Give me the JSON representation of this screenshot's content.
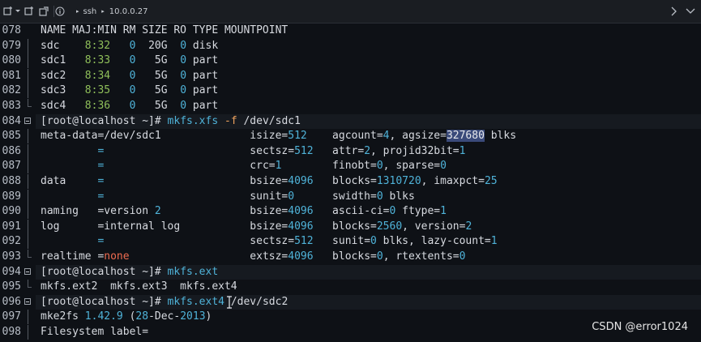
{
  "titlebar": {
    "ssh_label": "ssh",
    "host": "10.0.0.27"
  },
  "lines": [
    {
      "n": "078",
      "segs": [
        {
          "t": "NAME MAJ:MIN RM SIZE RO TYPE MOUNTPOINT",
          "c": ""
        }
      ]
    },
    {
      "n": "079",
      "segs": [
        {
          "t": "sdc    ",
          "c": ""
        },
        {
          "t": "8:32",
          "c": "c-green"
        },
        {
          "t": "   ",
          "c": ""
        },
        {
          "t": "0",
          "c": "c-cyan"
        },
        {
          "t": "  20G  ",
          "c": ""
        },
        {
          "t": "0",
          "c": "c-cyan"
        },
        {
          "t": " disk",
          "c": ""
        }
      ]
    },
    {
      "n": "080",
      "segs": [
        {
          "t": "sdc1   ",
          "c": ""
        },
        {
          "t": "8:33",
          "c": "c-green"
        },
        {
          "t": "   ",
          "c": ""
        },
        {
          "t": "0",
          "c": "c-cyan"
        },
        {
          "t": "   5G  ",
          "c": ""
        },
        {
          "t": "0",
          "c": "c-cyan"
        },
        {
          "t": " part",
          "c": ""
        }
      ]
    },
    {
      "n": "081",
      "segs": [
        {
          "t": "sdc2   ",
          "c": ""
        },
        {
          "t": "8:34",
          "c": "c-green"
        },
        {
          "t": "   ",
          "c": ""
        },
        {
          "t": "0",
          "c": "c-cyan"
        },
        {
          "t": "   5G  ",
          "c": ""
        },
        {
          "t": "0",
          "c": "c-cyan"
        },
        {
          "t": " part",
          "c": ""
        }
      ]
    },
    {
      "n": "082",
      "segs": [
        {
          "t": "sdc3   ",
          "c": ""
        },
        {
          "t": "8:35",
          "c": "c-green"
        },
        {
          "t": "   ",
          "c": ""
        },
        {
          "t": "0",
          "c": "c-cyan"
        },
        {
          "t": "   5G  ",
          "c": ""
        },
        {
          "t": "0",
          "c": "c-cyan"
        },
        {
          "t": " part",
          "c": ""
        }
      ]
    },
    {
      "n": "083",
      "segs": [
        {
          "t": "sdc4   ",
          "c": ""
        },
        {
          "t": "8:36",
          "c": "c-green"
        },
        {
          "t": "   ",
          "c": ""
        },
        {
          "t": "0",
          "c": "c-cyan"
        },
        {
          "t": "   5G  ",
          "c": ""
        },
        {
          "t": "0",
          "c": "c-cyan"
        },
        {
          "t": " part",
          "c": ""
        }
      ]
    },
    {
      "n": "084",
      "prompt": true,
      "segs": [
        {
          "t": "[root@localhost ~]# ",
          "c": ""
        },
        {
          "t": "mkfs.xfs",
          "c": "c-cyan"
        },
        {
          "t": " ",
          "c": ""
        },
        {
          "t": "-f",
          "c": "c-orange"
        },
        {
          "t": " /dev/sdc1",
          "c": ""
        }
      ]
    },
    {
      "n": "085",
      "segs": [
        {
          "t": "meta-data=/dev/sdc1              isize=",
          "c": ""
        },
        {
          "t": "512",
          "c": "c-cyan"
        },
        {
          "t": "    agcount=",
          "c": ""
        },
        {
          "t": "4",
          "c": "c-cyan"
        },
        {
          "t": ", agsize=",
          "c": ""
        },
        {
          "t": "327680",
          "c": "c-hl"
        },
        {
          "t": " blks",
          "c": ""
        }
      ]
    },
    {
      "n": "086",
      "segs": [
        {
          "t": "         ",
          "c": ""
        },
        {
          "t": "=",
          "c": "c-cyan"
        },
        {
          "t": "                       sectsz=",
          "c": ""
        },
        {
          "t": "512",
          "c": "c-cyan"
        },
        {
          "t": "   attr=",
          "c": ""
        },
        {
          "t": "2",
          "c": "c-cyan"
        },
        {
          "t": ", projid32bit=",
          "c": ""
        },
        {
          "t": "1",
          "c": "c-cyan"
        }
      ]
    },
    {
      "n": "087",
      "segs": [
        {
          "t": "         ",
          "c": ""
        },
        {
          "t": "=",
          "c": "c-cyan"
        },
        {
          "t": "                       crc=",
          "c": ""
        },
        {
          "t": "1",
          "c": "c-cyan"
        },
        {
          "t": "        finobt=",
          "c": ""
        },
        {
          "t": "0",
          "c": "c-cyan"
        },
        {
          "t": ", sparse=",
          "c": ""
        },
        {
          "t": "0",
          "c": "c-cyan"
        }
      ]
    },
    {
      "n": "088",
      "segs": [
        {
          "t": "data     ",
          "c": ""
        },
        {
          "t": "=",
          "c": "c-cyan"
        },
        {
          "t": "                       bsize=",
          "c": ""
        },
        {
          "t": "4096",
          "c": "c-cyan"
        },
        {
          "t": "   blocks=",
          "c": ""
        },
        {
          "t": "1310720",
          "c": "c-cyan"
        },
        {
          "t": ", imaxpct=",
          "c": ""
        },
        {
          "t": "25",
          "c": "c-cyan"
        }
      ]
    },
    {
      "n": "089",
      "segs": [
        {
          "t": "         ",
          "c": ""
        },
        {
          "t": "=",
          "c": "c-cyan"
        },
        {
          "t": "                       sunit=",
          "c": ""
        },
        {
          "t": "0",
          "c": "c-cyan"
        },
        {
          "t": "      swidth=",
          "c": ""
        },
        {
          "t": "0",
          "c": "c-cyan"
        },
        {
          "t": " blks",
          "c": ""
        }
      ]
    },
    {
      "n": "090",
      "segs": [
        {
          "t": "naming   =version ",
          "c": ""
        },
        {
          "t": "2",
          "c": "c-cyan"
        },
        {
          "t": "              bsize=",
          "c": ""
        },
        {
          "t": "4096",
          "c": "c-cyan"
        },
        {
          "t": "   ascii-ci=",
          "c": ""
        },
        {
          "t": "0",
          "c": "c-cyan"
        },
        {
          "t": " ftype=",
          "c": ""
        },
        {
          "t": "1",
          "c": "c-cyan"
        }
      ]
    },
    {
      "n": "091",
      "segs": [
        {
          "t": "log      =internal log           bsize=",
          "c": ""
        },
        {
          "t": "4096",
          "c": "c-cyan"
        },
        {
          "t": "   blocks=",
          "c": ""
        },
        {
          "t": "2560",
          "c": "c-cyan"
        },
        {
          "t": ", version=",
          "c": ""
        },
        {
          "t": "2",
          "c": "c-cyan"
        }
      ]
    },
    {
      "n": "092",
      "segs": [
        {
          "t": "         ",
          "c": ""
        },
        {
          "t": "=",
          "c": "c-cyan"
        },
        {
          "t": "                       sectsz=",
          "c": ""
        },
        {
          "t": "512",
          "c": "c-cyan"
        },
        {
          "t": "   sunit=",
          "c": ""
        },
        {
          "t": "0",
          "c": "c-cyan"
        },
        {
          "t": " blks, lazy-count=",
          "c": ""
        },
        {
          "t": "1",
          "c": "c-cyan"
        }
      ]
    },
    {
      "n": "093",
      "segs": [
        {
          "t": "realtime =",
          "c": ""
        },
        {
          "t": "none",
          "c": "c-red"
        },
        {
          "t": "                   extsz=",
          "c": ""
        },
        {
          "t": "4096",
          "c": "c-cyan"
        },
        {
          "t": "   blocks=",
          "c": ""
        },
        {
          "t": "0",
          "c": "c-cyan"
        },
        {
          "t": ", rtextents=",
          "c": ""
        },
        {
          "t": "0",
          "c": "c-cyan"
        }
      ]
    },
    {
      "n": "094",
      "prompt": true,
      "segs": [
        {
          "t": "[root@localhost ~]# ",
          "c": ""
        },
        {
          "t": "mkfs.ext",
          "c": "c-cyan"
        }
      ]
    },
    {
      "n": "095",
      "segs": [
        {
          "t": "mkfs.ext2  mkfs.ext3  mkfs.ext4",
          "c": ""
        }
      ]
    },
    {
      "n": "096",
      "prompt": true,
      "cursor": true,
      "segs": [
        {
          "t": "[root@localhost ~]# ",
          "c": ""
        },
        {
          "t": "mkfs.ext4",
          "c": "c-cyan"
        },
        {
          "t": " /dev/sdc2",
          "c": ""
        }
      ]
    },
    {
      "n": "097",
      "segs": [
        {
          "t": "mke2fs ",
          "c": ""
        },
        {
          "t": "1.42.9",
          "c": "c-cyan"
        },
        {
          "t": " (",
          "c": ""
        },
        {
          "t": "28",
          "c": "c-cyan"
        },
        {
          "t": "-Dec-",
          "c": ""
        },
        {
          "t": "2013",
          "c": "c-cyan"
        },
        {
          "t": ")",
          "c": ""
        }
      ]
    },
    {
      "n": "098",
      "segs": [
        {
          "t": "Filesystem label=",
          "c": ""
        }
      ]
    }
  ],
  "watermark": "CSDN @error1024",
  "colors": {
    "background": "#0e1116",
    "text": "#d7dae0",
    "number": "#4fb3d9",
    "majmin": "#8fbf5a",
    "flag": "#f0a35e",
    "none": "#ee6b50"
  }
}
